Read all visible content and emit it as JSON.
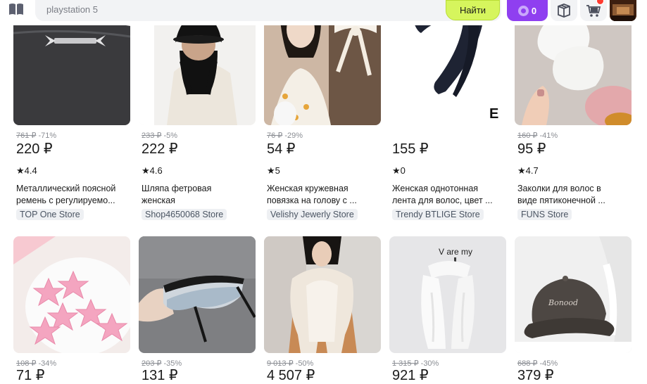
{
  "header": {
    "catalog_icon": "catalog-icon",
    "search_value": "playstation 5",
    "search_button_label": "Найти",
    "points_count": "0",
    "orders_icon": "orders-icon",
    "cart_icon": "cart-icon",
    "avatar_icon": "avatar"
  },
  "colors": {
    "search_button": "#d6f55d",
    "points": "#8f3ff0",
    "badge": "#ff3b30"
  },
  "products": [
    {
      "old_price": "761 ₽",
      "discount": "-71%",
      "price": "220 ₽",
      "rating": "4.4",
      "title_line1": "Металлический поясной",
      "title_line2": "ремень с регулируемо...",
      "store": "TOP One Store"
    },
    {
      "old_price": "233 ₽",
      "discount": "-5%",
      "price": "222 ₽",
      "rating": "4.6",
      "title_line1": "Шляпа фетровая",
      "title_line2": "женская",
      "store": "Shop4650068 Store"
    },
    {
      "old_price": "76 ₽",
      "discount": "-29%",
      "price": "54 ₽",
      "rating": "5",
      "title_line1": "Женская кружевная",
      "title_line2": "повязка на голову с ...",
      "store": "Velishy Jewerly Store",
      "image_text": ""
    },
    {
      "old_price": "",
      "discount": "",
      "price": "155 ₽",
      "rating": "0",
      "title_line1": "Женская однотонная",
      "title_line2": "лента для волос, цвет ...",
      "store": "Trendy BTLIGE Store",
      "image_text": "E"
    },
    {
      "old_price": "160 ₽",
      "discount": "-41%",
      "price": "95 ₽",
      "rating": "4.7",
      "title_line1": "Заколки для волос в",
      "title_line2": "виде пятиконечной ...",
      "store": "FUNS Store"
    },
    {
      "old_price": "108 ₽",
      "discount": "-34%",
      "price": "71 ₽"
    },
    {
      "old_price": "203 ₽",
      "discount": "-35%",
      "price": "131 ₽"
    },
    {
      "old_price": "9 013 ₽",
      "discount": "-50%",
      "price": "4 507 ₽"
    },
    {
      "old_price": "1 315 ₽",
      "discount": "-30%",
      "price": "921 ₽",
      "image_text": "V are my"
    },
    {
      "old_price": "688 ₽",
      "discount": "-45%",
      "price": "379 ₽"
    }
  ],
  "star": "★"
}
